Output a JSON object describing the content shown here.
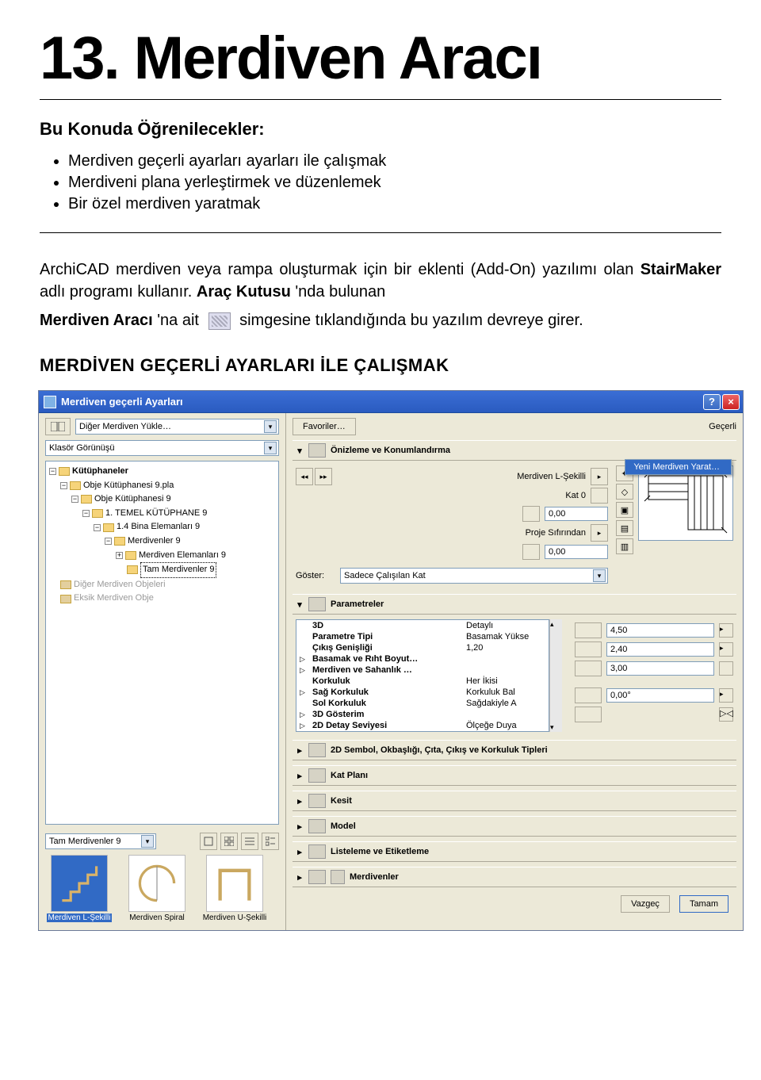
{
  "page": {
    "title": "13. Merdiven Aracı",
    "subhead": "Bu Konuda Öğrenilecekler:",
    "bullets": [
      "Merdiven geçerli ayarları ayarları ile çalışmak",
      "Merdiveni plana yerleştirmek ve düzenlemek",
      "Bir özel merdiven yaratmak"
    ],
    "para1_a": "ArchiCAD merdiven veya rampa oluşturmak için bir eklenti (Add-On) yazılımı olan ",
    "para1_b": "StairMaker",
    "para1_c": " adlı programı kullanır. ",
    "para1_d": "Araç Kutusu",
    "para1_e": "'nda bulunan",
    "para2_a": "Merdiven Aracı",
    "para2_b": "'na ait",
    "para2_c": "simgesine tıklandığında bu yazılım devreye girer.",
    "section": "MERDİVEN GEÇERLİ AYARLARI İLE ÇALIŞMAK"
  },
  "dialog": {
    "title": "Merdiven geçerli Ayarları",
    "help": "?",
    "close": "×",
    "top": {
      "load_other": "Diğer Merdiven Yükle…",
      "favorites": "Favoriler…",
      "scope": "Geçerli",
      "folder_view": "Klasör Görünüşü"
    },
    "tree": [
      {
        "level": 0,
        "pm": "−",
        "label": "Kütüphaneler"
      },
      {
        "level": 1,
        "pm": "−",
        "label": "Obje Kütüphanesi 9.pla"
      },
      {
        "level": 2,
        "pm": "−",
        "label": "Obje Kütüphanesi 9"
      },
      {
        "level": 3,
        "pm": "−",
        "label": "1. TEMEL KÜTÜPHANE 9"
      },
      {
        "level": 4,
        "pm": "−",
        "label": "1.4 Bina Elemanları 9"
      },
      {
        "level": 5,
        "pm": "−",
        "label": "Merdivenler 9"
      },
      {
        "level": 6,
        "pm": "+",
        "label": "Merdiven Elemanları 9"
      },
      {
        "level": 6,
        "pm": "",
        "label": "Tam Merdivenler 9",
        "selected": true
      },
      {
        "level": 0,
        "pm": "",
        "label": "Diğer Merdiven Objeleri",
        "dim": true
      },
      {
        "level": 0,
        "pm": "",
        "label": "Eksik Merdiven Obje",
        "dim": true
      }
    ],
    "thumb_combo": "Tam Merdivenler 9",
    "thumbs": [
      {
        "label": "Merdiven L-Şekilli",
        "selected": true
      },
      {
        "label": "Merdiven Spiral"
      },
      {
        "label": "Merdiven U-Şekilli"
      }
    ],
    "preview": {
      "header": "Önizleme ve Konumlandırma",
      "name": "Merdiven L-Şekilli",
      "menu_item": "Yeni Merdiven Yarat…",
      "story_label": "Kat 0",
      "height1": "0,00",
      "origin_label": "Proje Sıfırından",
      "height2": "0,00",
      "show_label": "Göster:",
      "show_value": "Sadece Çalışılan Kat"
    },
    "params": {
      "header": "Parametreler",
      "rows": [
        {
          "exp": "",
          "name": "3D",
          "val": "Detaylı"
        },
        {
          "exp": "",
          "name": "Parametre Tipi",
          "val": "Basamak Yükse"
        },
        {
          "exp": "",
          "name": "Çıkış Genişliği",
          "val": "1,20"
        },
        {
          "exp": "▷",
          "name": "Basamak ve Rıht Boyut…",
          "val": ""
        },
        {
          "exp": "▷",
          "name": "Merdiven ve Sahanlık …",
          "val": ""
        },
        {
          "exp": "",
          "name": "Korkuluk",
          "val": "Her İkisi"
        },
        {
          "exp": "▷",
          "name": "Sağ Korkuluk",
          "val": "Korkuluk Bal"
        },
        {
          "exp": "",
          "name": "Sol Korkuluk",
          "val": "Sağdakiyle A"
        },
        {
          "exp": "▷",
          "name": "3D Gösterim",
          "val": ""
        },
        {
          "exp": "▷",
          "name": "2D Detay Seviyesi",
          "val": "Ölçeğe Duya"
        }
      ],
      "dims": [
        {
          "value": "4,50"
        },
        {
          "value": "2,40"
        },
        {
          "value": "3,00"
        },
        {
          "value": "0,00°"
        },
        {
          "value": ""
        }
      ]
    },
    "collapsed": [
      "2D Sembol, Okbaşlığı, Çıta, Çıkış ve Korkuluk Tipleri",
      "Kat Planı",
      "Kesit",
      "Model",
      "Listeleme ve Etiketleme",
      "Merdivenler"
    ],
    "footer": {
      "cancel": "Vazgeç",
      "ok": "Tamam"
    }
  }
}
